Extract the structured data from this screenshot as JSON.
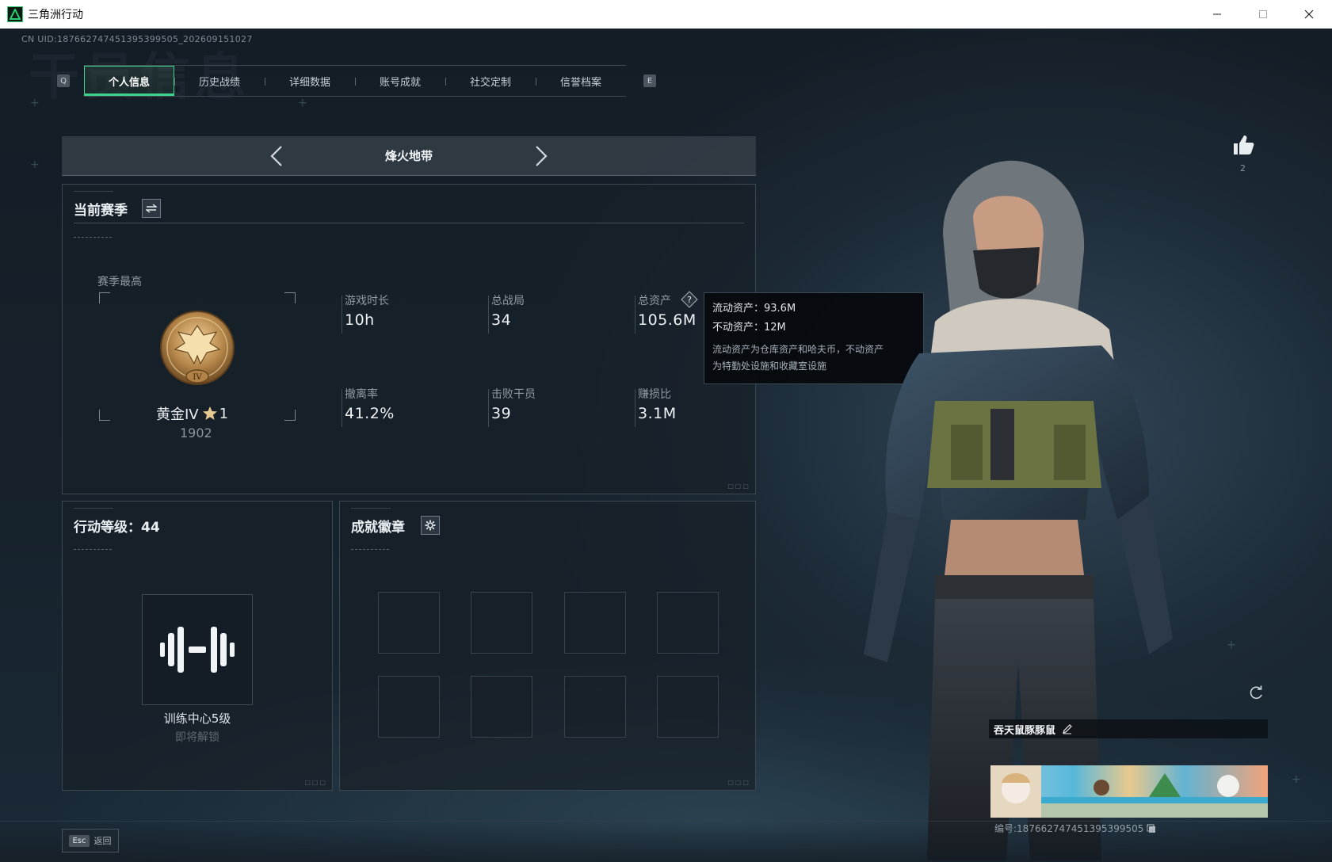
{
  "window": {
    "title": "三角洲行动"
  },
  "uid_line": "CN UID:187662747451395399505_202609151027",
  "tabs": {
    "left_key": "Q",
    "right_key": "E",
    "items": [
      {
        "label": "个人信息",
        "active": true
      },
      {
        "label": "历史战绩",
        "active": false
      },
      {
        "label": "详细数据",
        "active": false
      },
      {
        "label": "账号成就",
        "active": false
      },
      {
        "label": "社交定制",
        "active": false
      },
      {
        "label": "信誉档案",
        "active": false
      }
    ]
  },
  "mode": {
    "title": "烽火地带"
  },
  "season": {
    "title": "当前赛季",
    "peak_label": "赛季最高",
    "rank_name": "黄金IV",
    "rank_stars": "1",
    "rank_score": "1902",
    "rank_numeral": "IV",
    "stats": [
      {
        "label": "游戏时长",
        "value": "10h"
      },
      {
        "label": "总战局",
        "value": "34"
      },
      {
        "label": "总资产",
        "value": "105.6M"
      },
      {
        "label": "撤离率",
        "value": "41.2%"
      },
      {
        "label": "击败干员",
        "value": "39"
      },
      {
        "label": "赚损比",
        "value": "3.1M"
      }
    ]
  },
  "tooltip": {
    "liquid": "流动资产：93.6M",
    "fixed": "不动资产：12M",
    "note_line1": "流动资产为仓库资产和哈夫币，不动资产",
    "note_line2": "为特勤处设施和收藏室设施"
  },
  "action_level": {
    "title": "行动等级：44",
    "unlock_name": "训练中心5级",
    "unlock_status": "即将解锁"
  },
  "badges": {
    "title": "成就徽章",
    "slots": 8
  },
  "profile": {
    "likes": "2",
    "card_name": "吞天鼠豚豚鼠",
    "card_id": "编号:187662747451395399505"
  },
  "footer": {
    "esc_key": "Esc",
    "back_label": "返回"
  },
  "colors": {
    "accent": "#3ed28a",
    "bg": "#101820",
    "panel": "#18202a"
  },
  "icons": [
    "app-logo-icon",
    "minimize-icon",
    "maximize-icon",
    "close-icon",
    "chevron-left-icon",
    "chevron-right-icon",
    "swap-icon",
    "help-icon",
    "settings-icon",
    "dumbbell-icon",
    "thumbs-up-icon",
    "refresh-icon",
    "edit-icon",
    "copy-icon",
    "rank-emblem-icon",
    "star-icon"
  ]
}
